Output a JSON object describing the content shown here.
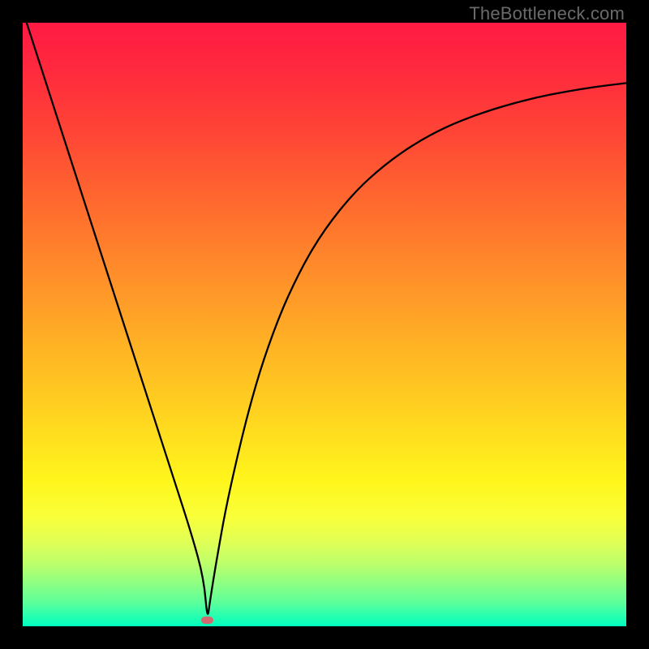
{
  "watermark": "TheBottleneck.com",
  "chart_data": {
    "type": "line",
    "title": "",
    "xlabel": "",
    "ylabel": "",
    "xlim": [
      0,
      1
    ],
    "ylim": [
      0,
      1
    ],
    "series": [
      {
        "name": "curve",
        "x": [
          0.0,
          0.05,
          0.1,
          0.15,
          0.2,
          0.25,
          0.28,
          0.3,
          0.306,
          0.31,
          0.32,
          0.34,
          0.38,
          0.42,
          0.46,
          0.5,
          0.55,
          0.6,
          0.65,
          0.7,
          0.75,
          0.8,
          0.85,
          0.9,
          0.95,
          1.0
        ],
        "y": [
          1.02,
          0.865,
          0.71,
          0.555,
          0.4,
          0.245,
          0.152,
          0.079,
          0.01,
          0.04,
          0.103,
          0.215,
          0.383,
          0.503,
          0.591,
          0.658,
          0.72,
          0.765,
          0.8,
          0.827,
          0.847,
          0.863,
          0.876,
          0.886,
          0.894,
          0.9
        ]
      }
    ],
    "marker": {
      "x": 0.306,
      "y": 0.01,
      "color": "#d36a6f"
    },
    "background_gradient": [
      "#ff1a44",
      "#ff6a2e",
      "#ffd71f",
      "#fff61c",
      "#00ffbe"
    ]
  },
  "colors": {
    "frame": "#000000",
    "curve_stroke": "#000000",
    "watermark": "#6a6a6a",
    "marker": "#d36a6f"
  }
}
